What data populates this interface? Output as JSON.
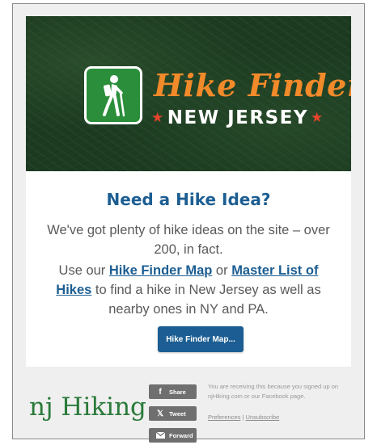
{
  "banner": {
    "title": "Hike Finder",
    "subtitle": "NEW JERSEY",
    "star": "★",
    "logo_icon": "hiker-icon"
  },
  "main": {
    "heading": "Need a Hike Idea?",
    "paragraph1": "We've got plenty of hike ideas on the site – over 200, in fact.",
    "paragraph2_before": "Use our ",
    "link1": "Hike Finder Map",
    "paragraph2_mid": " or ",
    "link2": "Master List of Hikes",
    "paragraph2_after": " to find a hike in New Jersey as well as nearby ones in NY and PA.",
    "cta_label": "Hike Finder Map..."
  },
  "footer": {
    "brand": "nj Hiking",
    "share_label": "Share",
    "tweet_label": "Tweet",
    "forward_label": "Forward",
    "notice": "You are receiving this because you signed up on njHiking.com or our Facebook page.",
    "preferences": "Preferences",
    "separator": "|",
    "unsubscribe": "Unsubscribe"
  },
  "colors": {
    "accent_blue": "#1c5e93",
    "title_orange": "#f18a2a",
    "star_red": "#e6442c",
    "brand_green": "#2a7a3a",
    "banner_dark_green": "#1c3b21"
  }
}
